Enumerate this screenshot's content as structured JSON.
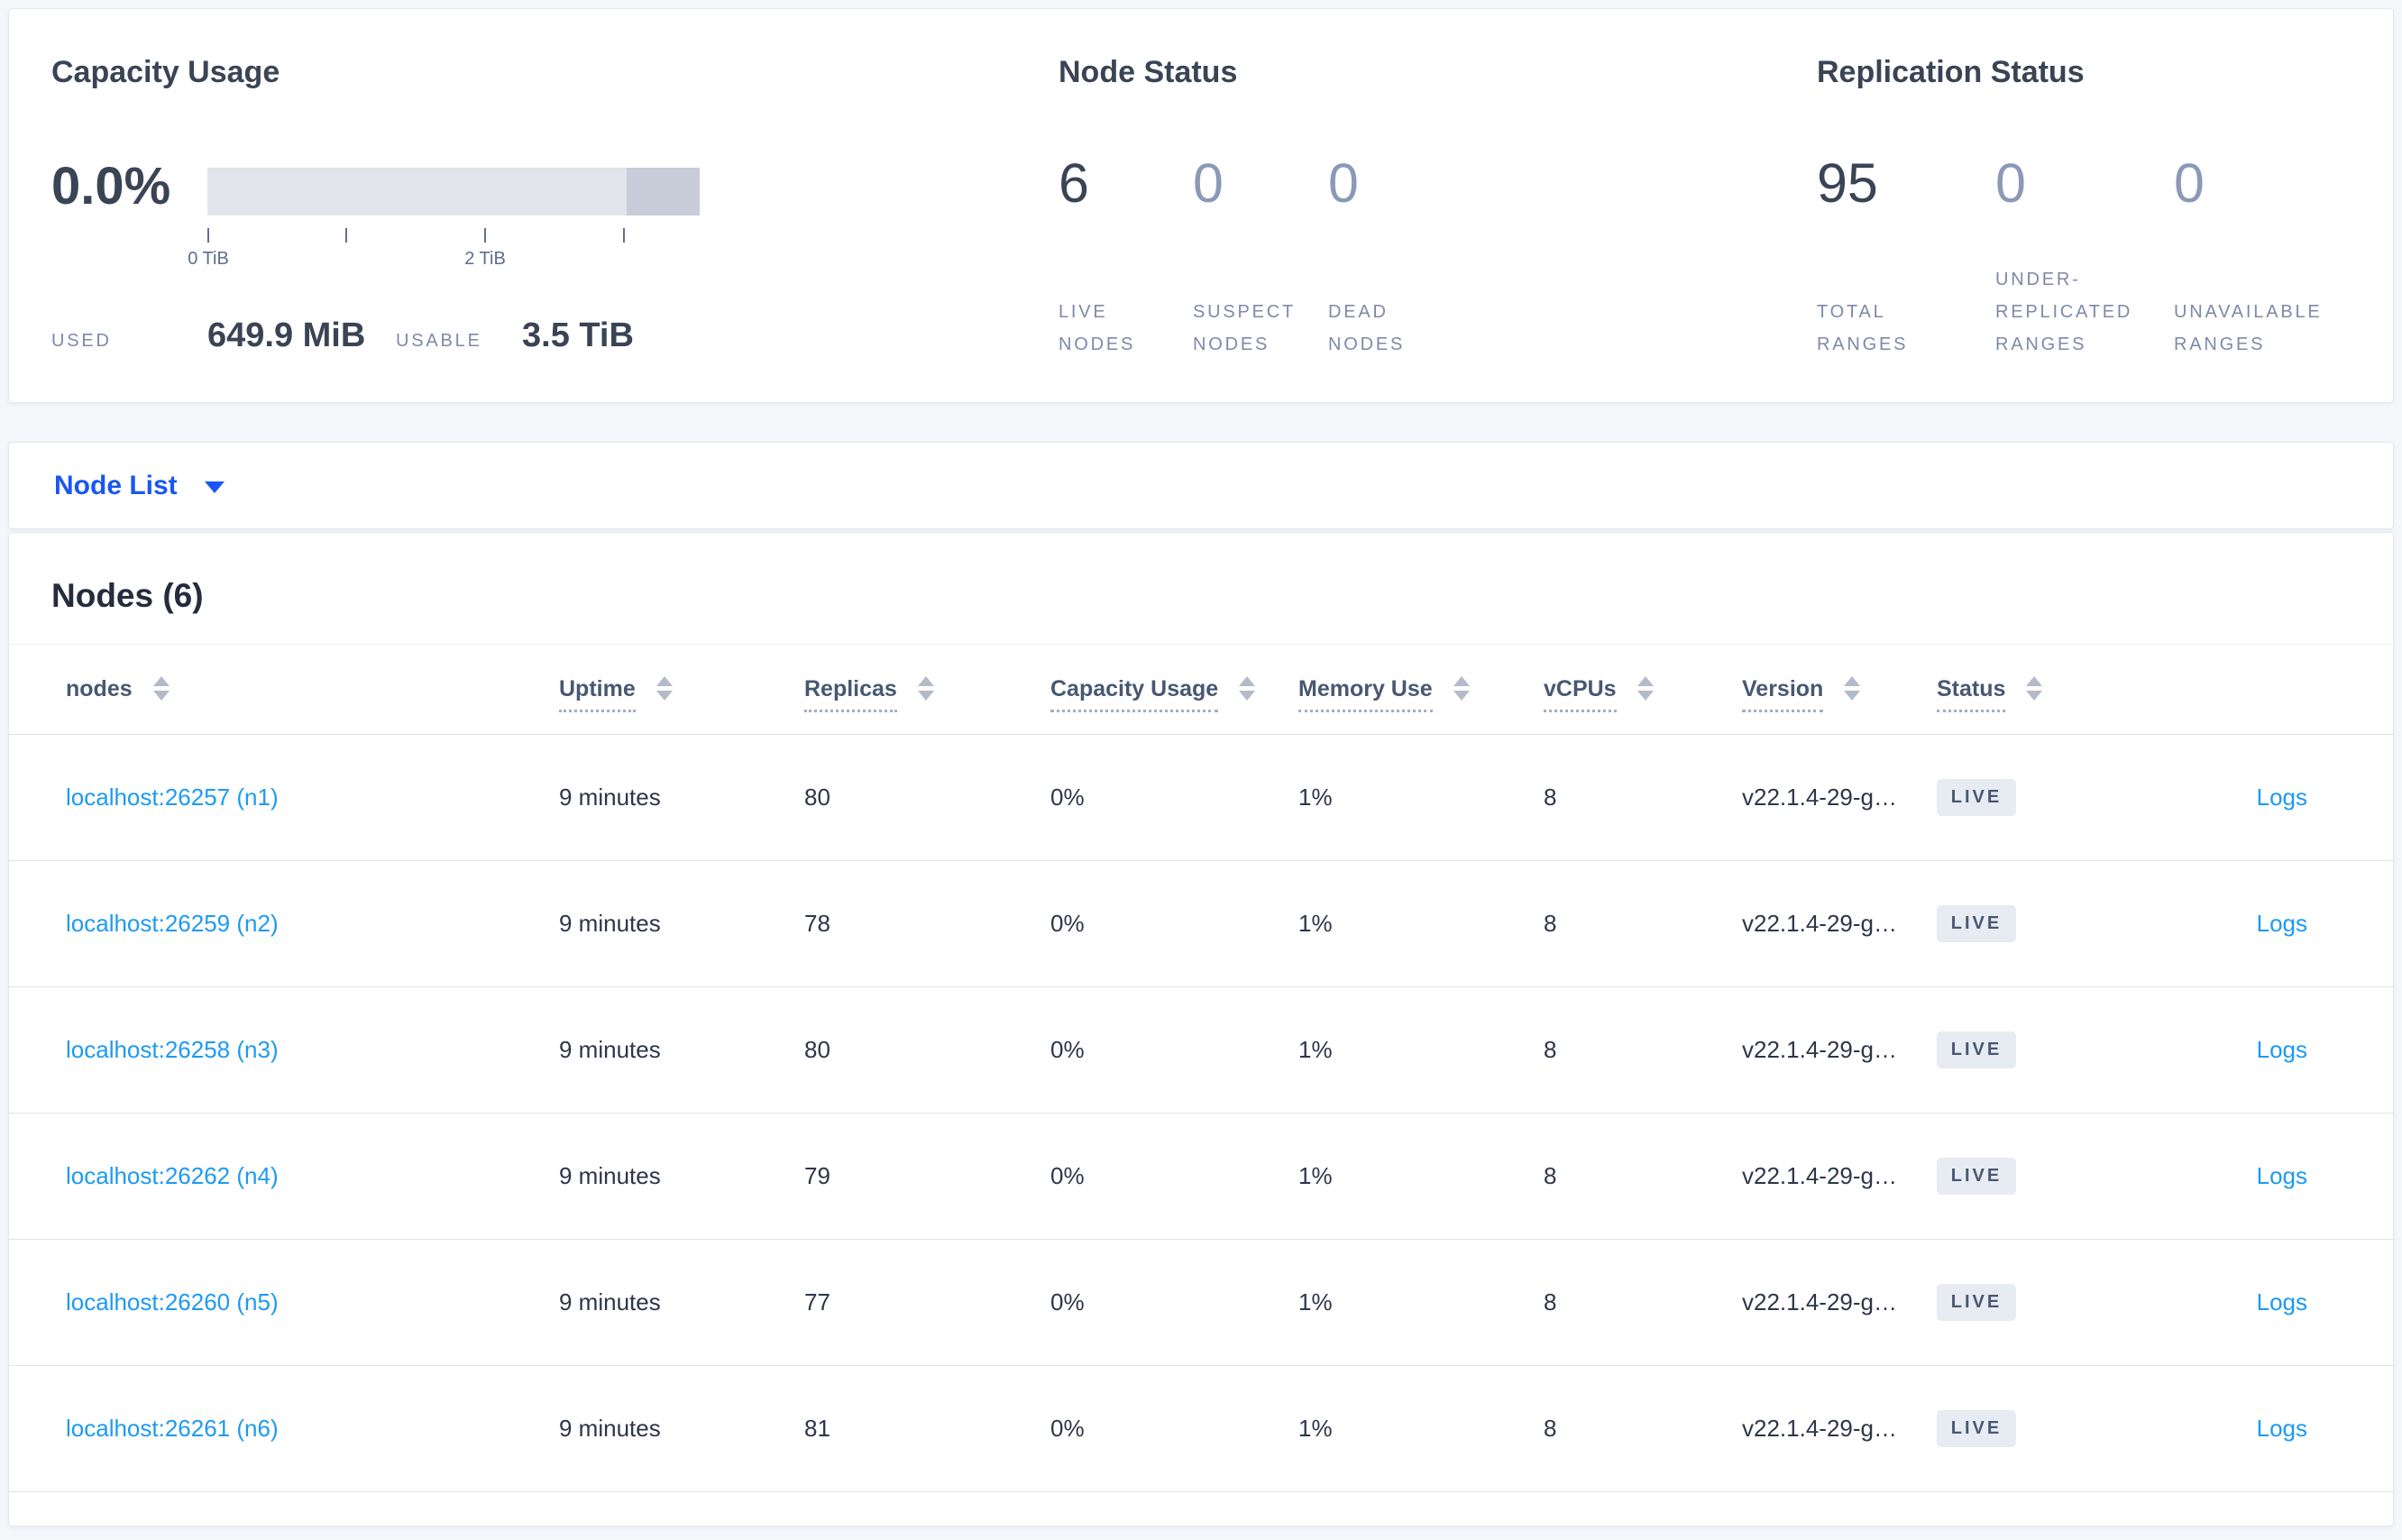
{
  "cluster_summary": {
    "capacity": {
      "title": "Capacity Usage",
      "percent_used": "0.0%",
      "tick_labels": [
        "0 TiB",
        "2 TiB"
      ],
      "used_label": "USED",
      "used_value": "649.9 MiB",
      "usable_label": "USABLE",
      "usable_value": "3.5 TiB"
    },
    "node_status": {
      "title": "Node Status",
      "stats": [
        {
          "value": "6",
          "label": "LIVE NODES"
        },
        {
          "value": "0",
          "label": "SUSPECT NODES"
        },
        {
          "value": "0",
          "label": "DEAD NODES"
        }
      ]
    },
    "replication_status": {
      "title": "Replication Status",
      "stats": [
        {
          "value": "95",
          "label": "TOTAL RANGES"
        },
        {
          "value": "0",
          "label": "UNDER-REPLICATED RANGES"
        },
        {
          "value": "0",
          "label": "UNAVAILABLE RANGES"
        }
      ]
    }
  },
  "view_selector": {
    "label": "Node List",
    "icon": "caret-down-icon"
  },
  "nodes_table": {
    "title": "Nodes (6)",
    "columns": [
      "nodes",
      "Uptime",
      "Replicas",
      "Capacity Usage",
      "Memory Use",
      "vCPUs",
      "Version",
      "Status"
    ],
    "rows": [
      {
        "node": "localhost:26257 (n1)",
        "uptime": "9 minutes",
        "replicas": "80",
        "capacity": "0%",
        "memory": "1%",
        "vcpus": "8",
        "version": "v22.1.4-29-g…",
        "status": "LIVE",
        "logs": "Logs"
      },
      {
        "node": "localhost:26259 (n2)",
        "uptime": "9 minutes",
        "replicas": "78",
        "capacity": "0%",
        "memory": "1%",
        "vcpus": "8",
        "version": "v22.1.4-29-g…",
        "status": "LIVE",
        "logs": "Logs"
      },
      {
        "node": "localhost:26258 (n3)",
        "uptime": "9 minutes",
        "replicas": "80",
        "capacity": "0%",
        "memory": "1%",
        "vcpus": "8",
        "version": "v22.1.4-29-g…",
        "status": "LIVE",
        "logs": "Logs"
      },
      {
        "node": "localhost:26262 (n4)",
        "uptime": "9 minutes",
        "replicas": "79",
        "capacity": "0%",
        "memory": "1%",
        "vcpus": "8",
        "version": "v22.1.4-29-g…",
        "status": "LIVE",
        "logs": "Logs"
      },
      {
        "node": "localhost:26260 (n5)",
        "uptime": "9 minutes",
        "replicas": "77",
        "capacity": "0%",
        "memory": "1%",
        "vcpus": "8",
        "version": "v22.1.4-29-g…",
        "status": "LIVE",
        "logs": "Logs"
      },
      {
        "node": "localhost:26261 (n6)",
        "uptime": "9 minutes",
        "replicas": "81",
        "capacity": "0%",
        "memory": "1%",
        "vcpus": "8",
        "version": "v22.1.4-29-g…",
        "status": "LIVE",
        "logs": "Logs"
      }
    ]
  },
  "colors": {
    "page_background": "#f4f6fa",
    "card_background": "#ffffff",
    "heading_text": "#394455",
    "muted_stat": "#8b99b8",
    "stat_label": "#7e89a9",
    "royal_blue_link": "#1a56f2",
    "azure_link": "#1d9af2",
    "capacity_bar_light": "#e2e4ec",
    "capacity_bar_dark": "#c9cdd9",
    "badge_background": "#e7ebf2",
    "badge_text": "#475872"
  }
}
